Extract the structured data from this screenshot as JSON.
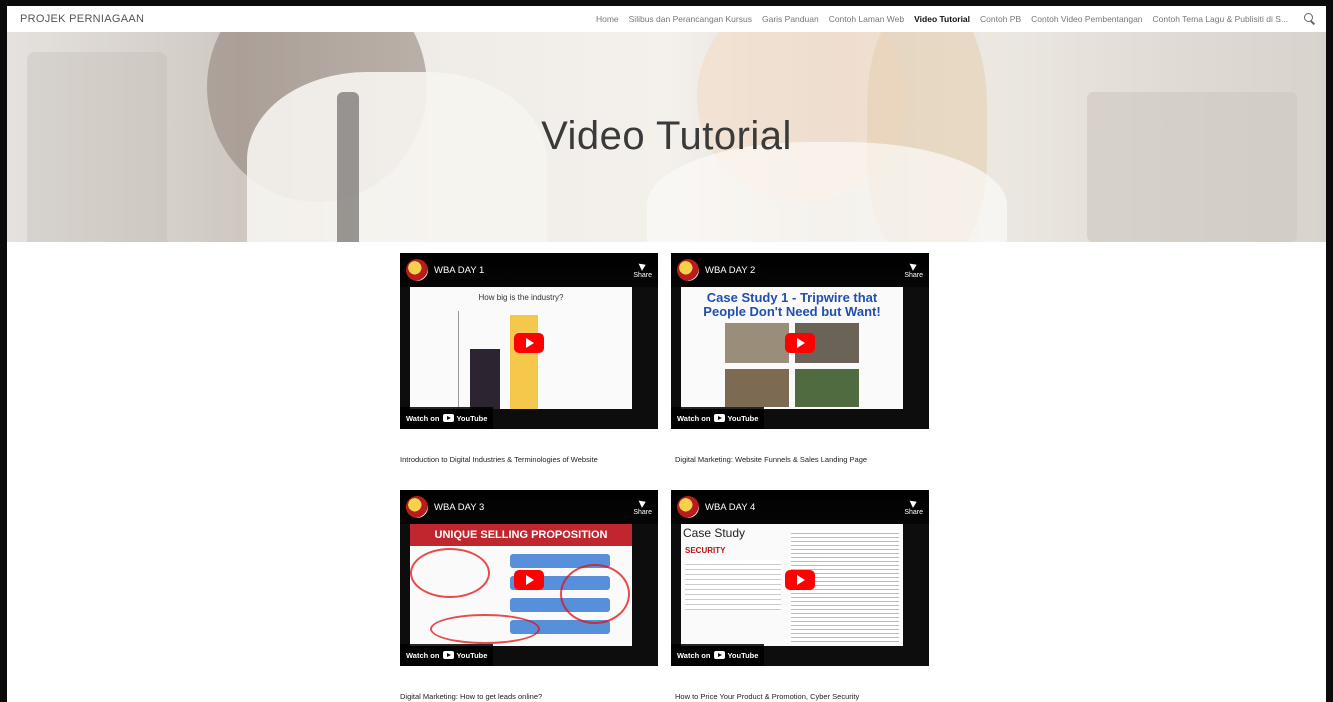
{
  "site": {
    "brand": "PROJEK PERNIAGAAN",
    "nav": [
      {
        "label": "Home",
        "active": false
      },
      {
        "label": "Silibus dan Perancangan Kursus",
        "active": false
      },
      {
        "label": "Garis Panduan",
        "active": false
      },
      {
        "label": "Contoh Laman Web",
        "active": false
      },
      {
        "label": "Video Tutorial",
        "active": true
      },
      {
        "label": "Contoh PB",
        "active": false
      },
      {
        "label": "Contoh Video Pembentangan",
        "active": false
      },
      {
        "label": "Contoh Tema Lagu & Publisiti di S...",
        "active": false
      }
    ],
    "search_icon": "search-icon"
  },
  "hero": {
    "title": "Video Tutorial"
  },
  "videos": [
    {
      "title": "WBA DAY 1",
      "caption": "Introduction to Digital Industries & Terminologies of Website",
      "slide_title": "How big is the industry?",
      "share": "Share",
      "watch_on": "Watch on",
      "platform": "YouTube"
    },
    {
      "title": "WBA DAY 2",
      "caption": "Digital Marketing: Website Funnels & Sales Landing Page",
      "slide_title": "Case Study 1 - Tripwire that People Don't Need but Want!",
      "share": "Share",
      "watch_on": "Watch on",
      "platform": "YouTube"
    },
    {
      "title": "WBA DAY 3",
      "caption": "Digital Marketing: How to get leads online?",
      "slide_title": "UNIQUE SELLING PROPOSITION",
      "share": "Share",
      "watch_on": "Watch on",
      "platform": "YouTube"
    },
    {
      "title": "WBA DAY 4",
      "caption": "How to Price Your Product & Promotion, Cyber Security",
      "slide_title": "Case Study",
      "slide_section": "SECURITY",
      "share": "Share",
      "watch_on": "Watch on",
      "platform": "YouTube"
    }
  ],
  "colors": {
    "play_button": "#ff0000",
    "frame": "#0b0b0b",
    "slide2_title": "#1f4fb0",
    "slide3_banner": "#c0262e"
  }
}
